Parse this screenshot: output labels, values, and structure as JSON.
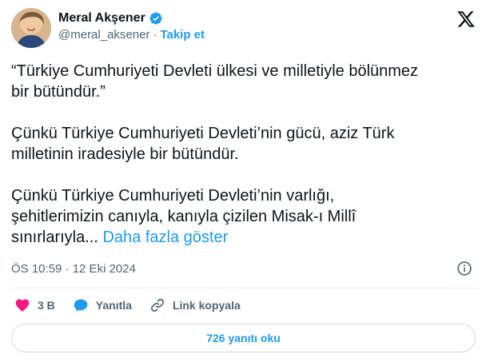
{
  "author": {
    "name": "Meral Akşener",
    "handle": "@meral_aksener",
    "separator": "·",
    "follow_label": "Takip et"
  },
  "tweet": {
    "paragraphs": [
      "“Türkiye Cumhuriyeti Devleti ülkesi ve milletiyle bölünmez\nbir bütündür.”",
      "Çünkü Türkiye Cumhuriyeti Devleti’nin gücü, aziz Türk\nmilletinin iradesiyle bir bütündür.",
      "Çünkü Türkiye Cumhuriyeti Devleti’nin varlığı,\nşehitlerimizin canıyla, kanıyla çizilen Misak-ı Millî\nsınırlarıyla..."
    ],
    "show_more": "Daha fazla göster",
    "timestamp": "ÖS 10:59 · 12 Eki 2024"
  },
  "actions": {
    "likes": "3 B",
    "reply": "Yanıtla",
    "copy_link": "Link kopyala"
  },
  "read_replies": "726 yanıtı oku",
  "colors": {
    "accent": "#1d9bf0",
    "like": "#f91880",
    "text": "#0f1419",
    "muted": "#536471"
  },
  "icons": [
    "avatar",
    "verified-badge-icon",
    "x-logo-icon",
    "info-icon",
    "heart-icon",
    "reply-bubble-icon",
    "link-icon"
  ]
}
